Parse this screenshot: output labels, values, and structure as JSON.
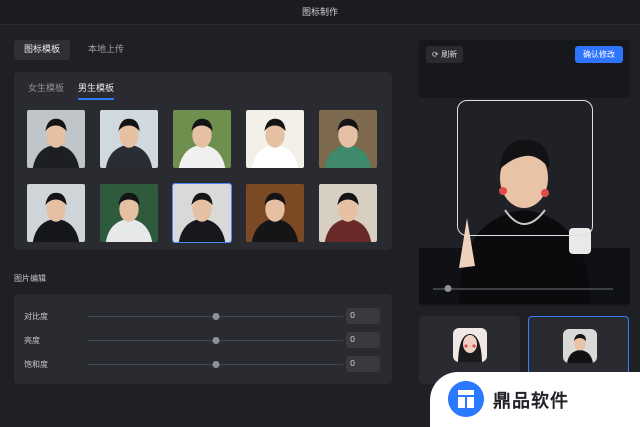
{
  "window": {
    "title": "图标制作"
  },
  "top_tabs": [
    {
      "label": "图标模板",
      "active": true
    },
    {
      "label": "本地上传",
      "active": false
    }
  ],
  "template_tabs": [
    {
      "label": "女生模板",
      "active": false
    },
    {
      "label": "男生模板",
      "active": true
    }
  ],
  "templates": [
    {
      "bg": "#bfc5c8",
      "shirt": "#1e1f23"
    },
    {
      "bg": "#cfd9de",
      "shirt": "#2a2d33"
    },
    {
      "bg": "#6f8f4f",
      "shirt": "#f0f0f0"
    },
    {
      "bg": "#f3f0ea",
      "shirt": "#ffffff"
    },
    {
      "bg": "#7d6a4e",
      "shirt": "#3f8a6a"
    },
    {
      "bg": "#cfd4d8",
      "shirt": "#15161a"
    },
    {
      "bg": "#2d5b3c",
      "shirt": "#e6e8ea"
    },
    {
      "bg": "#d9dad8",
      "shirt": "#17181c"
    },
    {
      "bg": "#7b4a24",
      "shirt": "#151517"
    },
    {
      "bg": "#d6cfc2",
      "shirt": "#6b2a2a"
    }
  ],
  "selected_template_index": 7,
  "edit": {
    "section_title": "图片编辑",
    "sliders": [
      {
        "label": "对比度",
        "value": "0",
        "level": 0.5
      },
      {
        "label": "亮度",
        "value": "0",
        "level": 0.5
      },
      {
        "label": "饱和度",
        "value": "0",
        "level": 0.5
      }
    ]
  },
  "preview": {
    "refresh_label": "刷新",
    "confirm_label": "确认修改",
    "zoom_level": 0.1
  },
  "icon_previews": [
    {
      "name": "female-avatar",
      "selected": false
    },
    {
      "name": "male-avatar",
      "selected": true
    }
  ],
  "brand": {
    "text": "鼎品软件"
  },
  "colors": {
    "accent": "#2f74ff",
    "background": "#1f2024",
    "panel": "#2a2b30"
  }
}
